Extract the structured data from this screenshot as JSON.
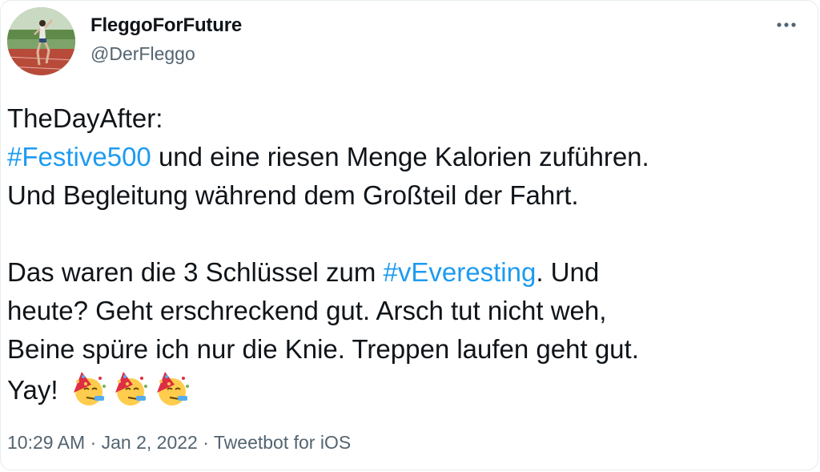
{
  "user": {
    "display_name": "FleggoForFuture",
    "handle": "@DerFleggo",
    "avatar_icon": "runner-photo-avatar"
  },
  "menu": {
    "more_label": "•••"
  },
  "tweet": {
    "line1": "TheDayAfter:",
    "hashtag1": "#Festive500",
    "line2_rest": " und eine riesen Menge Kalorien zuführen.",
    "line3": "Und Begleitung während dem Großteil der Fahrt.",
    "line4_start": "Das waren die 3 Schlüssel zum ",
    "hashtag2": "#vEveresting",
    "line4_end": ". Und",
    "line5": "heute? Geht erschreckend gut. Arsch tut nicht weh,",
    "line6": "Beine spüre ich nur die Knie. Treppen laufen geht gut.",
    "line7": "Yay!",
    "emojis": [
      "partying-face-emoji",
      "partying-face-emoji",
      "partying-face-emoji"
    ]
  },
  "meta": {
    "time": "10:29 AM",
    "separator": " · ",
    "date": "Jan 2, 2022",
    "source": "Tweetbot for iOS"
  },
  "colors": {
    "link": "#1d9bf0",
    "text": "#0f1419",
    "secondary": "#536471"
  }
}
